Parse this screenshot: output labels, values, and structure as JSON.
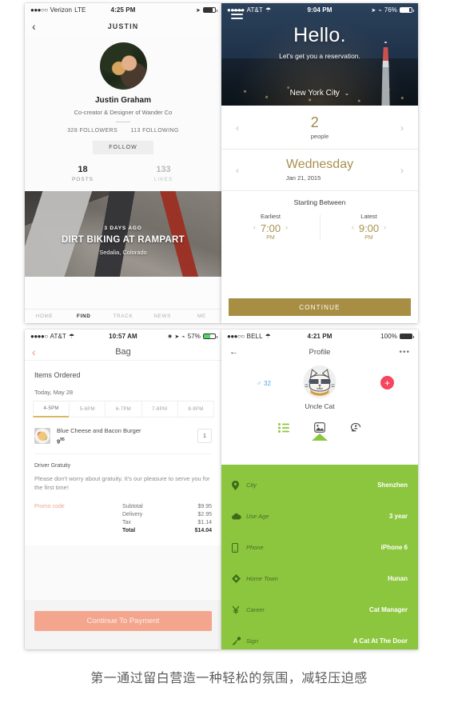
{
  "page": {
    "caption": "第一通过留白营造一种轻松的氛围，减轻压迫感"
  },
  "panel_profile": {
    "status": {
      "carrier": "Verizon",
      "network": "LTE",
      "time": "4:25 PM",
      "dots": "●●●○○"
    },
    "nav": {
      "back_icon": "chevron-left-icon",
      "title": "JUSTIN"
    },
    "user": {
      "name": "Justin Graham",
      "role": "Co-creator & Designer of Wander Co",
      "followers": "328 FOLLOWERS",
      "following": "113 FOLLOWING",
      "follow_button": "FOLLOW"
    },
    "stats": [
      {
        "num": "18",
        "label": "POSTS"
      },
      {
        "num": "133",
        "label": "LIKES"
      }
    ],
    "card": {
      "ago": "3 DAYS AGO",
      "title": "DIRT BIKING AT RAMPART",
      "location": "Sedalia, Colorado"
    },
    "tabs": [
      {
        "label": "HOME",
        "active": false
      },
      {
        "label": "FIND",
        "active": true
      },
      {
        "label": "TRACK",
        "active": false
      },
      {
        "label": "NEWS",
        "active": false
      },
      {
        "label": "ME",
        "active": false
      }
    ]
  },
  "panel_booking": {
    "status": {
      "carrier": "AT&T",
      "time": "9:04 PM",
      "battery": "76%",
      "dots": "●●●●●"
    },
    "hero": {
      "menu_icon": "hamburger-menu-icon",
      "greeting": "Hello.",
      "subtitle": "Let's get you a reservation.",
      "city": "New York City",
      "city_caret": "⌄"
    },
    "party": {
      "count": "2",
      "label": "people",
      "prev_icon": "chevron-left-icon",
      "next_icon": "chevron-right-icon"
    },
    "day": {
      "name": "Wednesday",
      "date": "Jan 21, 2015"
    },
    "starting": {
      "heading": "Starting Between"
    },
    "earliest": {
      "label": "Earliest",
      "time": "7:00",
      "meridiem": "PM"
    },
    "latest": {
      "label": "Latest",
      "time": "9:00",
      "meridiem": "PM"
    },
    "continue_label": "CONTINUE",
    "accent": "#a88e43"
  },
  "panel_bag": {
    "status": {
      "carrier": "AT&T",
      "time": "10:57 AM",
      "battery": "57%",
      "dots": "●●●●○"
    },
    "nav": {
      "back_icon": "chevron-left-icon",
      "title": "Bag"
    },
    "section_title": "Items Ordered",
    "date": "Today, May 28",
    "slots": [
      {
        "label": "4-5PM",
        "selected": true
      },
      {
        "label": "5-6PM",
        "selected": false
      },
      {
        "label": "6-7PM",
        "selected": false
      },
      {
        "label": "7-8PM",
        "selected": false
      },
      {
        "label": "8-9PM",
        "selected": false
      }
    ],
    "item": {
      "name": "Blue Cheese and Bacon Burger",
      "price": "9",
      "cents": "95",
      "qty": "1"
    },
    "gratuity": {
      "heading": "Driver Gratuity",
      "text": "Please don't worry about gratuity. It's our pleasure to serve you for the first time!"
    },
    "promo_label": "Promo code",
    "totals": [
      {
        "label": "Subtotal",
        "value": "$9.95",
        "bold": false
      },
      {
        "label": "Delivery",
        "value": "$2.95",
        "bold": false
      },
      {
        "label": "Tax",
        "value": "$1.14",
        "bold": false
      },
      {
        "label": "Total",
        "value": "$14.04",
        "bold": true
      }
    ],
    "pay_button": "Continue To Payment",
    "accent": "#f4a58e"
  },
  "panel_catprofile": {
    "status": {
      "carrier": "BELL",
      "time": "4:21 PM",
      "battery": "100%",
      "dots": "●●●○○"
    },
    "nav": {
      "back_icon": "arrow-left-icon",
      "title": "Profile",
      "more_icon": "more-horizontal-icon"
    },
    "user": {
      "name": "Uncle Cat",
      "gender_icon": "male-gender-icon",
      "age": "32",
      "add_icon": "plus-icon"
    },
    "tabs": [
      {
        "icon": "list-icon",
        "active": true
      },
      {
        "icon": "image-icon",
        "active": false
      },
      {
        "icon": "chat-icon",
        "active": false
      }
    ],
    "info": [
      {
        "icon": "location-pin-icon",
        "label": "City",
        "value": "Shenzhen"
      },
      {
        "icon": "cloud-icon",
        "label": "Use Age",
        "value": "3 year"
      },
      {
        "icon": "phone-icon",
        "label": "Phone",
        "value": "iPhone 6"
      },
      {
        "icon": "home-icon",
        "label": "Home Town",
        "value": "Hunan"
      },
      {
        "icon": "yen-icon",
        "label": "Career",
        "value": "Cat Manager"
      },
      {
        "icon": "key-icon",
        "label": "Sign",
        "value": "A Cat At The Door"
      }
    ],
    "green": "#8cc63e"
  }
}
